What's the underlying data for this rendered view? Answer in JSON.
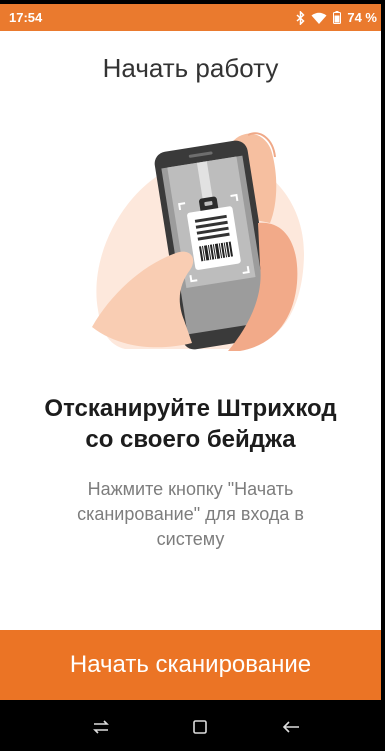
{
  "status_bar": {
    "time": "17:54",
    "battery": "74 %",
    "icons": [
      "bluetooth-icon",
      "wifi-icon",
      "battery-icon"
    ]
  },
  "title": "Начать работу",
  "heading": "Отсканируйте Штрихкод\nсо своего бейджа",
  "instructions": "Нажмите кнопку \"Начать\nсканирование\" для входа в\nсистему",
  "scan_button": {
    "label": "Начать сканирование"
  },
  "nav_bar": {
    "icons": [
      "recent-apps-icon",
      "home-icon",
      "back-icon"
    ]
  },
  "colors": {
    "accent": "#EB7425",
    "status_bar": "#EA7A2E",
    "title_text": "#333333",
    "heading_text": "#1C1C1C",
    "body_text": "#7D7D7D",
    "nav_bar": "#000000"
  }
}
